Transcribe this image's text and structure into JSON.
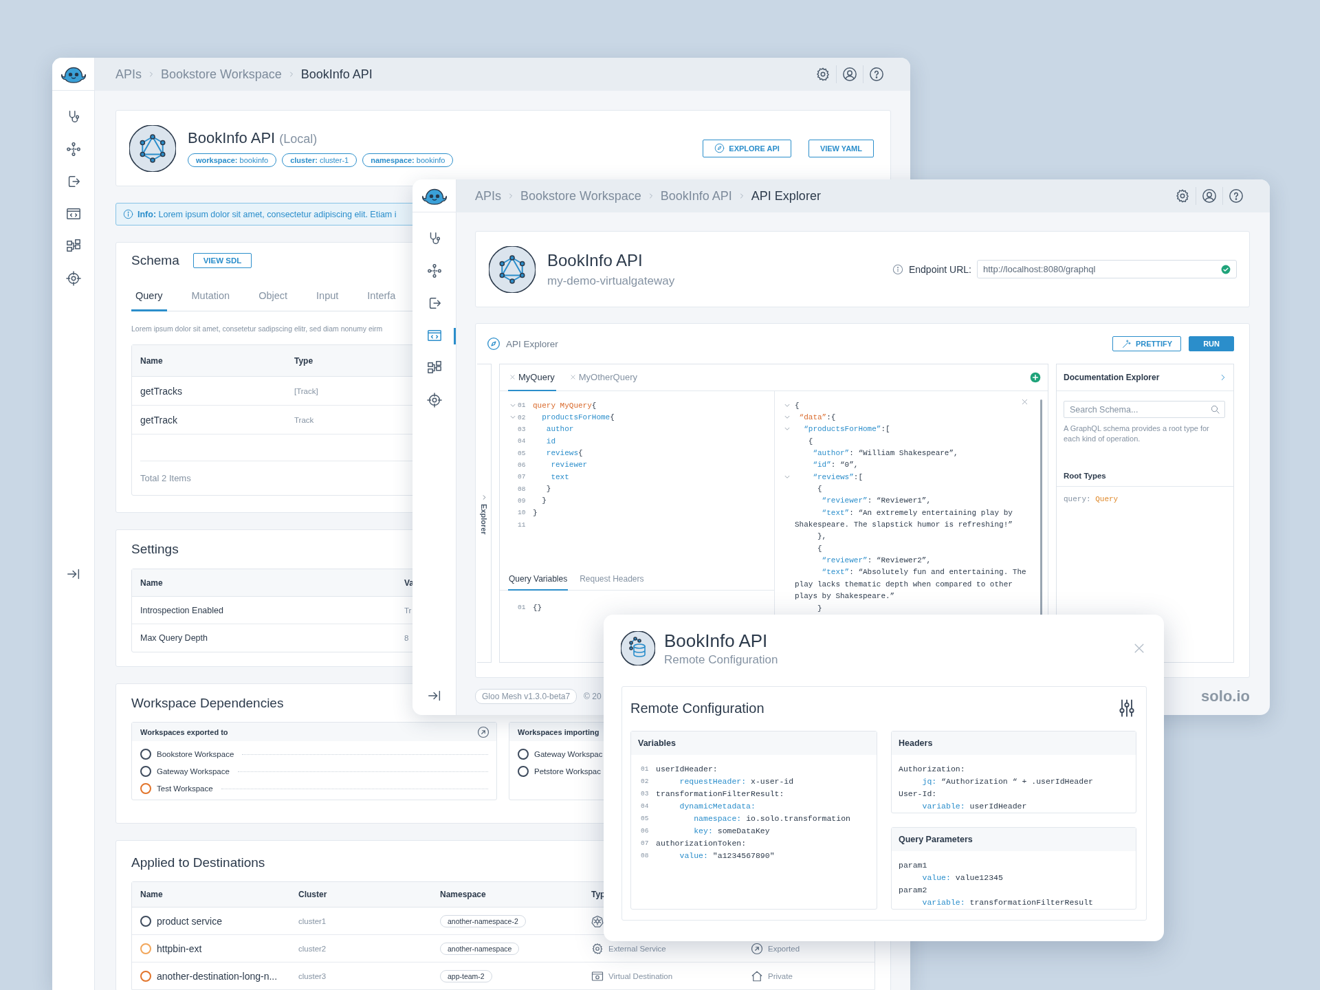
{
  "back_window": {
    "sidebar": {
      "items": [
        {
          "kind": "stethoscope",
          "selected": false
        },
        {
          "kind": "network",
          "selected": false
        },
        {
          "kind": "exit",
          "selected": false
        },
        {
          "kind": "code",
          "selected": false
        },
        {
          "kind": "diagram",
          "selected": false
        },
        {
          "kind": "crosshair",
          "selected": false
        }
      ]
    },
    "breadcrumb": [
      "APIs",
      "Bookstore Workspace",
      "BookInfo API"
    ],
    "api": {
      "title": "BookInfo API",
      "qualifier": "(Local)",
      "tags": [
        "**workspace:** bookinfo",
        "**cluster:** cluster-1",
        "**namespace:** bookinfo"
      ],
      "buttons": [
        {
          "label": "EXPLORE API",
          "kind": "compass"
        },
        {
          "label": "VIEW YAML",
          "kind": "plain"
        }
      ]
    },
    "info_banner": "**Info:** Lorem ipsum dolor sit amet, consectetur adipiscing elit. Etiam i",
    "schema": {
      "title": "Schema",
      "button": "VIEW SDL",
      "tabs": [
        {
          "label": "Query",
          "selected": true
        },
        {
          "label": "Mutation",
          "selected": false
        },
        {
          "label": "Object",
          "selected": false
        },
        {
          "label": "Input",
          "selected": false
        },
        {
          "label": "Interfa",
          "selected": false
        }
      ],
      "description": "Lorem ipsum dolor sit amet, consetetur sadipscing elitr, sed diam nonumy eirm",
      "columns": [
        "Name",
        "Type"
      ],
      "rows": [
        {
          "name": "getTracks",
          "type": "[Track]"
        },
        {
          "name": "getTrack",
          "type": "Track"
        }
      ],
      "footer": "Total 2 Items"
    },
    "settings": {
      "title": "Settings",
      "columns": [
        "Name",
        "Va"
      ],
      "rows": [
        {
          "name": "Introspection Enabled",
          "value": "Tr"
        },
        {
          "name": "Max Query Depth",
          "value": "8"
        }
      ]
    },
    "dependencies": {
      "title": "Workspace Dependencies",
      "groups": [
        {
          "title": "Workspaces exported to",
          "items": [
            {
              "label": "Bookstore Workspace",
              "color": "#3d4a5c"
            },
            {
              "label": "Gateway Workspace",
              "color": "#3d4a5c"
            },
            {
              "label": "Test Workspace",
              "color": "#e2742b"
            }
          ]
        },
        {
          "title": "Workspaces importing",
          "items": [
            {
              "label": "Gateway Workspac",
              "color": "#3d4a5c"
            },
            {
              "label": "Petstore Workspac",
              "color": "#3d4a5c"
            }
          ]
        }
      ]
    },
    "destinations": {
      "title": "Applied to Destinations",
      "columns": [
        "Name",
        "Cluster",
        "Namespace",
        "Typ"
      ],
      "rows": [
        {
          "name": "product service",
          "color": "#3d4a5c",
          "cluster": "cluster1",
          "namespace": "another-namespace-2",
          "type": {
            "kind": "kubernetes"
          }
        },
        {
          "name": "httpbin-ext",
          "color": "#f2a65a",
          "cluster": "cluster2",
          "namespace": "another-namespace",
          "type": {
            "kind": "external",
            "label": "External Service"
          },
          "visibility": {
            "kind": "exported",
            "label": "Exported"
          }
        },
        {
          "name": "another-destination-long-n...",
          "color": "#e2742b",
          "cluster": "cluster3",
          "namespace": "app-team-2",
          "type": {
            "kind": "virtual",
            "label": "Virtual Destination"
          },
          "visibility": {
            "kind": "private",
            "label": "Private"
          }
        }
      ]
    }
  },
  "explorer_window": {
    "sidebar": {
      "items": [
        {
          "kind": "stethoscope",
          "selected": false
        },
        {
          "kind": "network",
          "selected": false
        },
        {
          "kind": "exit",
          "selected": false
        },
        {
          "kind": "code",
          "selected": true
        },
        {
          "kind": "diagram",
          "selected": false
        },
        {
          "kind": "crosshair",
          "selected": false
        }
      ]
    },
    "breadcrumb": [
      "APIs",
      "Bookstore Workspace",
      "BookInfo API",
      "API Explorer"
    ],
    "api": {
      "title": "BookInfo API",
      "subtitle": "my-demo-virtualgateway",
      "endpoint_label": "Endpoint URL:",
      "endpoint_value": "http://localhost:8080/graphql"
    },
    "explorer": {
      "title": "API Explorer",
      "buttons": [
        {
          "label": "PRETTIFY",
          "kind": "wand"
        },
        {
          "label": "RUN",
          "kind": "primary"
        }
      ],
      "side_tab": "Explorer",
      "query_tabs": [
        {
          "label": "MyQuery",
          "selected": true
        },
        {
          "label": "MyOtherQuery",
          "selected": false
        }
      ],
      "query_lines": [
        {
          "n": "01",
          "foldable": true,
          "parts": [
            {
              "text": "query MyQuery",
              "kind": "kw"
            },
            {
              "text": "{",
              "kind": "p"
            }
          ]
        },
        {
          "n": "02",
          "foldable": true,
          "parts": [
            {
              "text": "  productsForHome",
              "kind": "field"
            },
            {
              "text": "{",
              "kind": "p"
            }
          ]
        },
        {
          "n": "03",
          "foldable": false,
          "parts": [
            {
              "text": "   author",
              "kind": "field"
            }
          ]
        },
        {
          "n": "04",
          "foldable": false,
          "parts": [
            {
              "text": "   id",
              "kind": "field"
            }
          ]
        },
        {
          "n": "05",
          "foldable": false,
          "parts": [
            {
              "text": "   reviews",
              "kind": "field"
            },
            {
              "text": "{",
              "kind": "p"
            }
          ]
        },
        {
          "n": "06",
          "foldable": false,
          "parts": [
            {
              "text": "    reviewer",
              "kind": "field"
            }
          ]
        },
        {
          "n": "07",
          "foldable": false,
          "parts": [
            {
              "text": "    text",
              "kind": "field"
            }
          ]
        },
        {
          "n": "08",
          "foldable": false,
          "parts": [
            {
              "text": "   }",
              "kind": "p"
            }
          ]
        },
        {
          "n": "09",
          "foldable": false,
          "parts": [
            {
              "text": "  }",
              "kind": "p"
            }
          ]
        },
        {
          "n": "10",
          "foldable": false,
          "parts": [
            {
              "text": "}",
              "kind": "p"
            }
          ]
        },
        {
          "n": "11",
          "foldable": false
        }
      ],
      "variables_tabs": [
        {
          "label": "Query Variables",
          "selected": true
        },
        {
          "label": "Request Headers",
          "selected": false
        }
      ],
      "variables_lines": [
        {
          "n": "01",
          "parts": [
            {
              "text": "{}",
              "kind": "p"
            }
          ]
        }
      ],
      "result_lines": [
        {
          "foldable": true,
          "parts": [
            {
              "text": "{",
              "kind": "p"
            }
          ]
        },
        {
          "foldable": true,
          "parts": [
            {
              "text": " “data”",
              "kind": "kw"
            },
            {
              "text": ":{",
              "kind": "p"
            }
          ]
        },
        {
          "foldable": true,
          "parts": [
            {
              "text": "  “productsForHome”",
              "kind": "key"
            },
            {
              "text": ":[",
              "kind": "p"
            }
          ]
        },
        {
          "foldable": false,
          "parts": [
            {
              "text": "   {",
              "kind": "p"
            }
          ]
        },
        {
          "foldable": false,
          "parts": [
            {
              "text": "    “author”",
              "kind": "key"
            },
            {
              "text": ": “William Shakespeare”,",
              "kind": "p"
            }
          ]
        },
        {
          "foldable": false,
          "parts": [
            {
              "text": "    “id”",
              "kind": "key"
            },
            {
              "text": ": “0”,",
              "kind": "p"
            }
          ]
        },
        {
          "foldable": true,
          "parts": [
            {
              "text": "    “reviews”",
              "kind": "key"
            },
            {
              "text": ":[",
              "kind": "p"
            }
          ]
        },
        {
          "foldable": false,
          "parts": [
            {
              "text": "     {",
              "kind": "p"
            }
          ]
        },
        {
          "foldable": false,
          "parts": [
            {
              "text": "      “reviewer”",
              "kind": "key"
            },
            {
              "text": ": “Reviewer1”,",
              "kind": "p"
            }
          ]
        },
        {
          "foldable": false,
          "parts": [
            {
              "text": "      “text”",
              "kind": "key"
            },
            {
              "text": ": “An extremely entertaining play by",
              "kind": "p"
            }
          ]
        },
        {
          "foldable": false,
          "parts": [
            {
              "text": "Shakespeare. The slapstick humor is refreshing!”",
              "kind": "p"
            }
          ]
        },
        {
          "foldable": false,
          "parts": [
            {
              "text": "     },",
              "kind": "p"
            }
          ]
        },
        {
          "foldable": false,
          "parts": [
            {
              "text": "     {",
              "kind": "p"
            }
          ]
        },
        {
          "foldable": false,
          "parts": [
            {
              "text": "      “reviewer”",
              "kind": "key"
            },
            {
              "text": ": “Reviewer2”,",
              "kind": "p"
            }
          ]
        },
        {
          "foldable": false,
          "parts": [
            {
              "text": "      “text”",
              "kind": "key"
            },
            {
              "text": ": “Absolutely fun and entertaining. The",
              "kind": "p"
            }
          ]
        },
        {
          "foldable": false,
          "parts": [
            {
              "text": "play lacks thematic depth when compared to other",
              "kind": "p"
            }
          ]
        },
        {
          "foldable": false,
          "parts": [
            {
              "text": "plays by Shakespeare.”",
              "kind": "p"
            }
          ]
        },
        {
          "foldable": false,
          "parts": [
            {
              "text": "     }",
              "kind": "p"
            }
          ]
        }
      ],
      "doc_explorer": {
        "title": "Documentation Explorer",
        "search_placeholder": "Search Schema...",
        "description": "A GraphQL schema provides a root type for each kind of operation.",
        "section": "Root Types",
        "root_types": [
          {
            "parts": [
              {
                "text": "query: ",
                "kind": "muted"
              },
              {
                "text": "Query",
                "kind": "type"
              }
            ]
          }
        ]
      }
    },
    "footer": {
      "version": "Gloo Mesh v1.3.0-beta7",
      "copyright": "© 20",
      "brand": "solo.io"
    }
  },
  "remote_config_dialog": {
    "title": "BookInfo API",
    "subtitle": "Remote Configuration",
    "section_title": "Remote Configuration",
    "panels": [
      {
        "title": "Variables",
        "lines": [
          {
            "n": "01",
            "parts": [
              {
                "text": "userIdHeader:",
                "kind": "p"
              }
            ]
          },
          {
            "n": "02",
            "parts": [
              {
                "text": "     requestHeader:",
                "kind": "key"
              },
              {
                "text": " x-user-id",
                "kind": "p"
              }
            ]
          },
          {
            "n": "03",
            "parts": [
              {
                "text": "transformationFilterResult:",
                "kind": "p"
              }
            ]
          },
          {
            "n": "04",
            "parts": [
              {
                "text": "     dynamicMetadata:",
                "kind": "key"
              }
            ]
          },
          {
            "n": "05",
            "parts": [
              {
                "text": "        namespace:",
                "kind": "key"
              },
              {
                "text": " io.solo.transformation",
                "kind": "p"
              }
            ]
          },
          {
            "n": "06",
            "parts": [
              {
                "text": "        key:",
                "kind": "key"
              },
              {
                "text": " someDataKey",
                "kind": "p"
              }
            ]
          },
          {
            "n": "07",
            "parts": [
              {
                "text": "authorizationToken:",
                "kind": "p"
              }
            ]
          },
          {
            "n": "08",
            "parts": [
              {
                "text": "     value:",
                "kind": "key"
              },
              {
                "text": " \"a1234567890\"",
                "kind": "p"
              }
            ]
          }
        ]
      },
      {
        "title": "Headers",
        "lines": [
          {
            "parts": [
              {
                "text": "Authorization:",
                "kind": "p"
              }
            ]
          },
          {
            "parts": [
              {
                "text": "     jq:",
                "kind": "key"
              },
              {
                "text": " “Authorization “ + .userIdHeader",
                "kind": "p"
              }
            ]
          },
          {
            "parts": [
              {
                "text": "User-Id:",
                "kind": "p"
              }
            ]
          },
          {
            "parts": [
              {
                "text": "     variable:",
                "kind": "key"
              },
              {
                "text": " userIdHeader",
                "kind": "p"
              }
            ]
          }
        ]
      },
      {
        "title": "Query Parameters",
        "lines": [
          {
            "parts": [
              {
                "text": "param1",
                "kind": "p"
              }
            ]
          },
          {
            "parts": [
              {
                "text": "     value:",
                "kind": "key"
              },
              {
                "text": " value12345",
                "kind": "p"
              }
            ]
          },
          {
            "parts": [
              {
                "text": "param2",
                "kind": "p"
              }
            ]
          },
          {
            "parts": [
              {
                "text": "     variable:",
                "kind": "key"
              },
              {
                "text": " transformationFilterResult",
                "kind": "p"
              }
            ]
          }
        ]
      }
    ]
  }
}
